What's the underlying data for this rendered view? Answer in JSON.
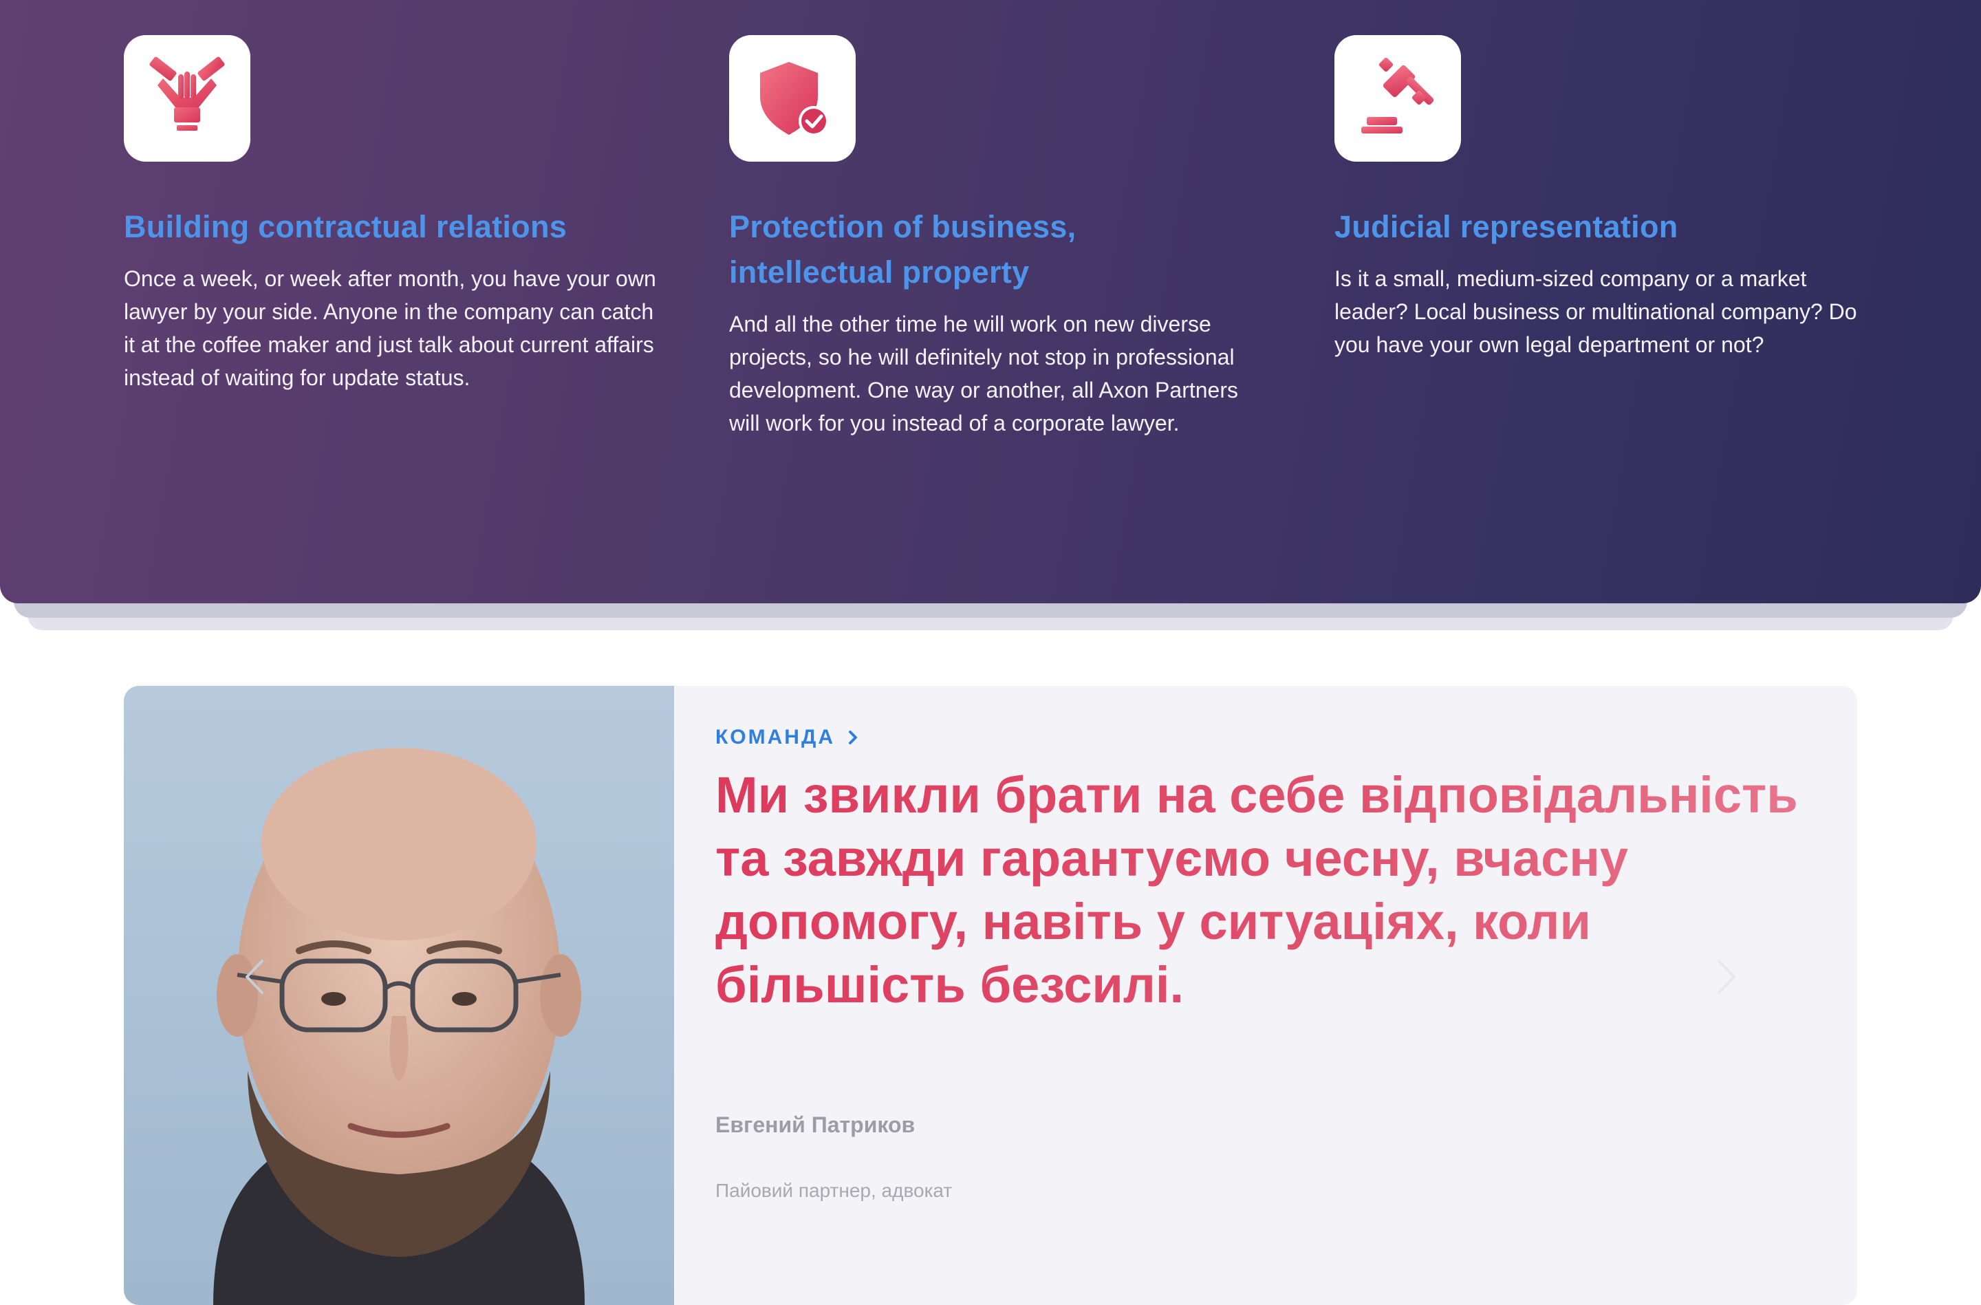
{
  "services": [
    {
      "icon": "handshake-hands-icon",
      "title": "Building contractual relations",
      "text": "Once a week, or week after month, you have your own lawyer by your side. Anyone in the company can catch it at the coffee maker and just talk about current affairs instead of waiting for update status."
    },
    {
      "icon": "shield-check-icon",
      "title": "Protection of business, intellectual property",
      "text": "And all the other time he will work on new diverse projects, so he will definitely not stop in professional development. One way or another, all Axon Partners will work for you instead of a corporate lawyer."
    },
    {
      "icon": "gavel-icon",
      "title": "Judicial representation",
      "text": "Is it a small, medium-sized company or a market leader? Local business or multinational company? Do you have your own legal department or not?"
    }
  ],
  "team_quote": {
    "kicker": "КОМАНДА",
    "quote": "Ми звикли брати на себе відповідальність та завжди гарантуємо чесну, вчасну допомогу, навіть у ситуаціях, коли більшість безсилі.",
    "author_name": "Евгений Патриков",
    "author_role": "Пайовий партнер, адвокат"
  },
  "colors": {
    "accent_blue": "#4d95ea",
    "accent_pink": "#dd3a5c",
    "banner_gradient_start": "#603f72",
    "banner_gradient_end": "#2e2d5a"
  }
}
